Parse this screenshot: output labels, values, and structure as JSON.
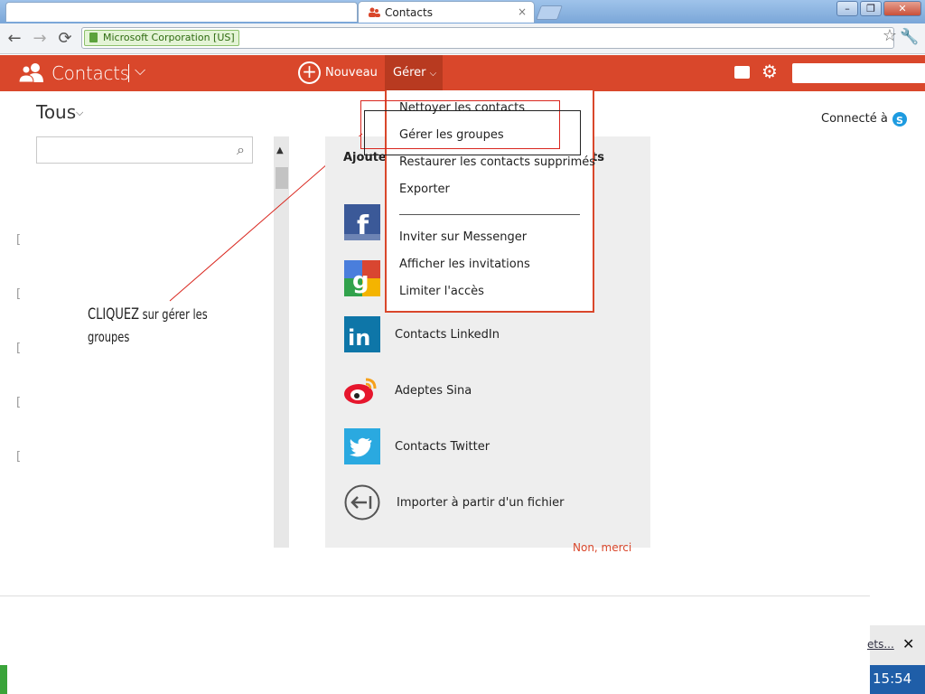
{
  "browser": {
    "tab_title": "Contacts",
    "tab_close": "×",
    "window_controls": [
      "–",
      "❐",
      "✕"
    ],
    "address_badge": "Microsoft Corporation [US]",
    "back_icon": "back-arrow-icon",
    "forward_icon": "forward-arrow-icon",
    "reload_icon": "reload-icon"
  },
  "appbar": {
    "title": "Contacts",
    "new_label": "Nouveau",
    "manage_label": "Gérer",
    "accent_color": "#d9472b"
  },
  "left": {
    "filter_label": "Tous",
    "search_placeholder": ""
  },
  "status": {
    "connected_label": "Connecté à"
  },
  "annotation": {
    "word1": "CLIQUEZ",
    "rest": "sur gérer les",
    "line2": "groupes"
  },
  "panel": {
    "heading_left": "Ajouter",
    "heading_right": "ts",
    "services": [
      {
        "label": ""
      },
      {
        "label": ""
      },
      {
        "label": "Contacts LinkedIn"
      },
      {
        "label": "Adeptes Sina"
      },
      {
        "label": "Contacts Twitter"
      },
      {
        "label": "Importer à partir d'un fichier"
      }
    ],
    "dismiss_label": "Non, merci"
  },
  "menu": {
    "items": [
      "Nettoyer les contacts",
      "Gérer les groupes",
      "Restaurer les contacts supprimés",
      "Exporter",
      "Inviter sur Messenger",
      "Afficher les invitations",
      "Limiter l'accès"
    ]
  },
  "bottom": {
    "link_text": "ets...",
    "close": "✕",
    "clock": "15:54"
  }
}
